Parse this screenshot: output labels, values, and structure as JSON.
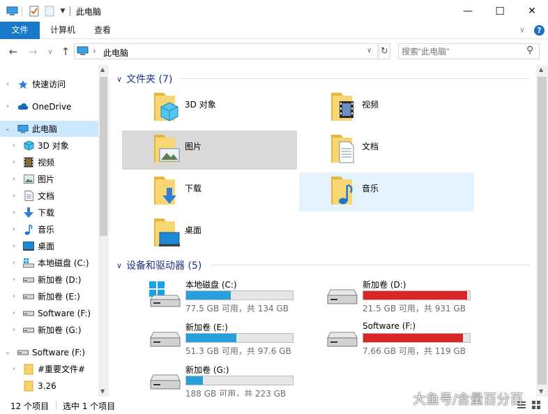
{
  "window": {
    "title": "此电脑",
    "minimize": "—",
    "maximize": "☐",
    "close": "✕"
  },
  "ribbon": {
    "tabs": [
      "文件",
      "计算机",
      "查看"
    ],
    "help_glyph": "?",
    "expand_glyph": "∨"
  },
  "nav": {
    "back": "←",
    "forward": "→",
    "recent": "∨",
    "up": "↑",
    "address": "此电脑",
    "breadcrumb_sep": "›",
    "dropdown": "∨",
    "refresh": "↻",
    "search_placeholder": "搜索\"此电脑\"",
    "search_glyph": "⚲"
  },
  "sidebar": {
    "items": [
      {
        "label": "快速访问",
        "icon": "star-icon",
        "expanded": false
      },
      {
        "label": "OneDrive",
        "icon": "cloud-icon",
        "expanded": false
      },
      {
        "label": "此电脑",
        "icon": "computer-icon",
        "expanded": true
      },
      {
        "label": "3D 对象",
        "icon": "cube-icon"
      },
      {
        "label": "视频",
        "icon": "film-icon"
      },
      {
        "label": "图片",
        "icon": "picture-icon"
      },
      {
        "label": "文档",
        "icon": "document-icon"
      },
      {
        "label": "下载",
        "icon": "download-arrow-icon"
      },
      {
        "label": "音乐",
        "icon": "music-note-icon"
      },
      {
        "label": "桌面",
        "icon": "desktop-icon"
      },
      {
        "label": "本地磁盘 (C:)",
        "icon": "system-drive-icon"
      },
      {
        "label": "新加卷 (D:)",
        "icon": "drive-icon"
      },
      {
        "label": "新加卷 (E:)",
        "icon": "drive-icon"
      },
      {
        "label": "Software (F:)",
        "icon": "drive-icon"
      },
      {
        "label": "新加卷 (G:)",
        "icon": "drive-icon"
      },
      {
        "label": "Software (F:)",
        "icon": "drive-icon",
        "expanded": true
      },
      {
        "label": "#重要文件#",
        "icon": "folder-icon"
      },
      {
        "label": "3.26",
        "icon": "folder-icon"
      }
    ]
  },
  "groups": {
    "folders": {
      "title": "文件夹 (7)"
    },
    "devices": {
      "title": "设备和驱动器 (5)"
    }
  },
  "folders": [
    {
      "name": "3D 对象",
      "overlay": "cube"
    },
    {
      "name": "视频",
      "overlay": "film"
    },
    {
      "name": "图片",
      "overlay": "picture"
    },
    {
      "name": "文档",
      "overlay": "document"
    },
    {
      "name": "下载",
      "overlay": "download"
    },
    {
      "name": "音乐",
      "overlay": "music"
    },
    {
      "name": "桌面",
      "overlay": "desktop"
    }
  ],
  "drives": [
    {
      "name": "本地磁盘 (C:)",
      "free": "77.5 GB 可用，共 134 GB",
      "used_fraction": 0.42,
      "color": "#26a0da",
      "system": true
    },
    {
      "name": "新加卷 (D:)",
      "free": "21.5 GB 可用，共 931 GB",
      "used_fraction": 0.977,
      "color": "#da2626",
      "system": false
    },
    {
      "name": "新加卷 (E:)",
      "free": "51.3 GB 可用，共 97.6 GB",
      "used_fraction": 0.47,
      "color": "#26a0da",
      "system": false
    },
    {
      "name": "Software (F:)",
      "free": "7.66 GB 可用，共 119 GB",
      "used_fraction": 0.936,
      "color": "#da2626",
      "system": false
    },
    {
      "name": "新加卷 (G:)",
      "free": "188 GB 可用，共 223 GB",
      "used_fraction": 0.16,
      "color": "#26a0da",
      "system": false
    }
  ],
  "status": {
    "items": "12 个项目",
    "selected": "选中 1 个项目"
  },
  "watermark": "大鱼号/含量百分百"
}
